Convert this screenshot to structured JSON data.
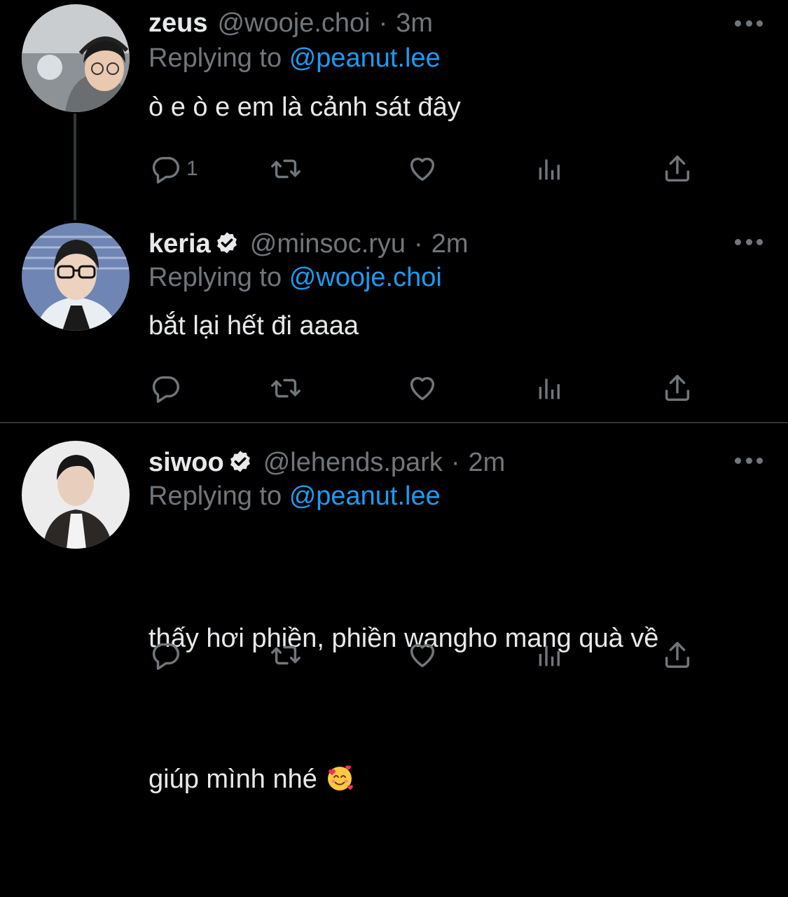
{
  "tweets": [
    {
      "name": "zeus",
      "verified": false,
      "handle": "@wooje.choi",
      "dot": "·",
      "time": "3m",
      "replying_prefix": "Replying to",
      "replying_to": "@peanut.lee",
      "text": "ò e ò e em là cảnh sát đây",
      "reply_count": "1"
    },
    {
      "name": "keria",
      "verified": true,
      "handle": "@minsoc.ryu",
      "dot": "·",
      "time": "2m",
      "replying_prefix": "Replying to",
      "replying_to": "@wooje.choi",
      "text": "bắt lại hết đi aaaa",
      "reply_count": ""
    },
    {
      "name": "siwoo",
      "verified": true,
      "handle": "@lehends.park",
      "dot": "·",
      "time": "2m",
      "replying_prefix": "Replying to",
      "replying_to": "@peanut.lee",
      "text_line1": "thấy hơi phiền, phiền wangho mang quà về",
      "text_line2": "giúp mình nhé",
      "reply_count": ""
    }
  ],
  "icons": {
    "reply": "reply-icon",
    "retweet": "retweet-icon",
    "like": "heart-icon",
    "views": "views-icon",
    "share": "share-icon",
    "more": "more-icon",
    "verified": "verified-icon",
    "emoji": "smiling-face-with-hearts-emoji"
  },
  "colors": {
    "background": "#000000",
    "text": "#e7e9ea",
    "muted": "#71767b",
    "link": "#1d9bf0",
    "divider": "#2f3336"
  }
}
